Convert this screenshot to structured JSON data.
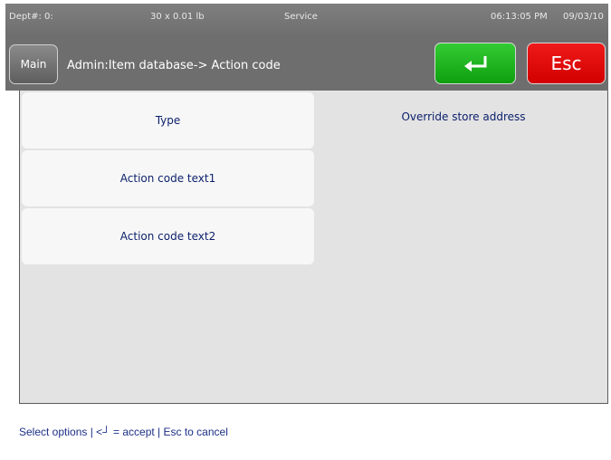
{
  "status": {
    "dept": "Dept#: 0:",
    "weight": "30 x 0.01 lb",
    "mode": "Service",
    "time": "06:13:05 PM",
    "date": "09/03/10"
  },
  "header": {
    "main_label": "Main",
    "breadcrumb": "Admin:Item database-> Action code",
    "esc_label": "Esc",
    "enter_icon": "enter-arrow-icon"
  },
  "options": [
    {
      "label": "Type"
    },
    {
      "label": "Action code text1"
    },
    {
      "label": "Action code text2"
    }
  ],
  "value_display": "Override store address",
  "footer": {
    "hint": "Select options | <┘ = accept | Esc to cancel"
  },
  "colors": {
    "accept": "#1fb21f",
    "cancel": "#e60000",
    "header_bg": "#6e6e6e",
    "content_bg": "#e3e3e3",
    "text_blue": "#0b1f6b"
  }
}
